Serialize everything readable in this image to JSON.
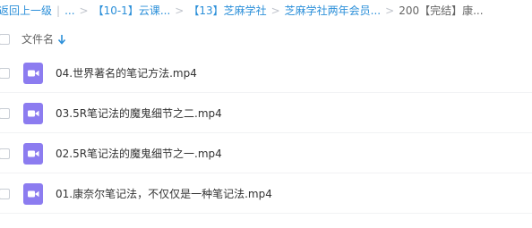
{
  "breadcrumb": {
    "back": "返回上一级",
    "ellipsis": "...",
    "items": [
      "【10-1】云课...",
      "【13】芝麻学社",
      "芝麻学社两年会员..."
    ],
    "current": "200【完结】康..."
  },
  "header": {
    "column_label": "文件名",
    "sort_icon": "arrow-down-icon"
  },
  "files": [
    {
      "name": "04.世界著名的笔记方法.mp4",
      "icon": "video-file-icon"
    },
    {
      "name": "03.5R笔记法的魔鬼细节之二.mp4",
      "icon": "video-file-icon"
    },
    {
      "name": "02.5R笔记法的魔鬼细节之一.mp4",
      "icon": "video-file-icon"
    },
    {
      "name": "01.康奈尔笔记法，不仅仅是一种笔记法.mp4",
      "icon": "video-file-icon"
    }
  ],
  "colors": {
    "link": "#2b8fd9",
    "video_icon": "#8c7cf0",
    "row_divider": "#f1f2f4"
  }
}
